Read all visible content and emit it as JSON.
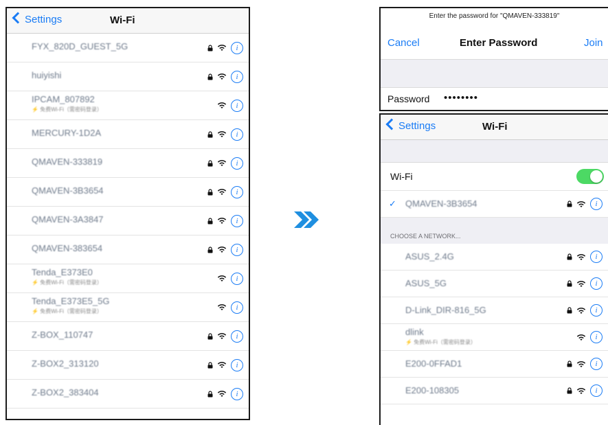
{
  "left": {
    "back_label": "Settings",
    "title": "Wi-Fi",
    "networks": [
      {
        "name": "FYX_820D_GUEST_5G",
        "sub": "",
        "lock": true
      },
      {
        "name": "huiyishi",
        "sub": "",
        "lock": true
      },
      {
        "name": "IPCAM_807892",
        "sub": "免费Wi-Fi（需密码登录）",
        "lock": false
      },
      {
        "name": "MERCURY-1D2A",
        "sub": "",
        "lock": true
      },
      {
        "name": "QMAVEN-333819",
        "sub": "",
        "lock": true
      },
      {
        "name": "QMAVEN-3B3654",
        "sub": "",
        "lock": true
      },
      {
        "name": "QMAVEN-3A3847",
        "sub": "",
        "lock": true
      },
      {
        "name": "QMAVEN-383654",
        "sub": "",
        "lock": true
      },
      {
        "name": "Tenda_E373E0",
        "sub": "免费Wi-Fi（需密码登录）",
        "lock": false
      },
      {
        "name": "Tenda_E373E5_5G",
        "sub": "免费Wi-Fi（需密码登录）",
        "lock": false
      },
      {
        "name": "Z-BOX_110747",
        "sub": "",
        "lock": true
      },
      {
        "name": "Z-BOX2_313120",
        "sub": "",
        "lock": true
      },
      {
        "name": "Z-BOX2_383404",
        "sub": "",
        "lock": true
      }
    ]
  },
  "password_dialog": {
    "prompt": "Enter the password for \"QMAVEN-333819\"",
    "cancel_label": "Cancel",
    "title": "Enter Password",
    "join_label": "Join",
    "field_label": "Password",
    "field_value": "••••••••"
  },
  "right": {
    "back_label": "Settings",
    "title": "Wi-Fi",
    "wifi_label": "Wi-Fi",
    "wifi_enabled": true,
    "connected": {
      "name": "QMAVEN-3B3654",
      "checkmark": "✓"
    },
    "section_header": "CHOOSE A NETWORK...",
    "networks": [
      {
        "name": "ASUS_2.4G",
        "sub": "",
        "lock": true
      },
      {
        "name": "ASUS_5G",
        "sub": "",
        "lock": true
      },
      {
        "name": "D-Link_DIR-816_5G",
        "sub": "",
        "lock": true
      },
      {
        "name": "dlink",
        "sub": "免费Wi-Fi（需密码登录）",
        "lock": false
      },
      {
        "name": "E200-0FFAD1",
        "sub": "",
        "lock": true
      },
      {
        "name": "E200-108305",
        "sub": "",
        "lock": true
      }
    ]
  },
  "colors": {
    "accent": "#1a7cf5",
    "toggle_on": "#4cd964",
    "arrow": "#1f8fe0"
  }
}
